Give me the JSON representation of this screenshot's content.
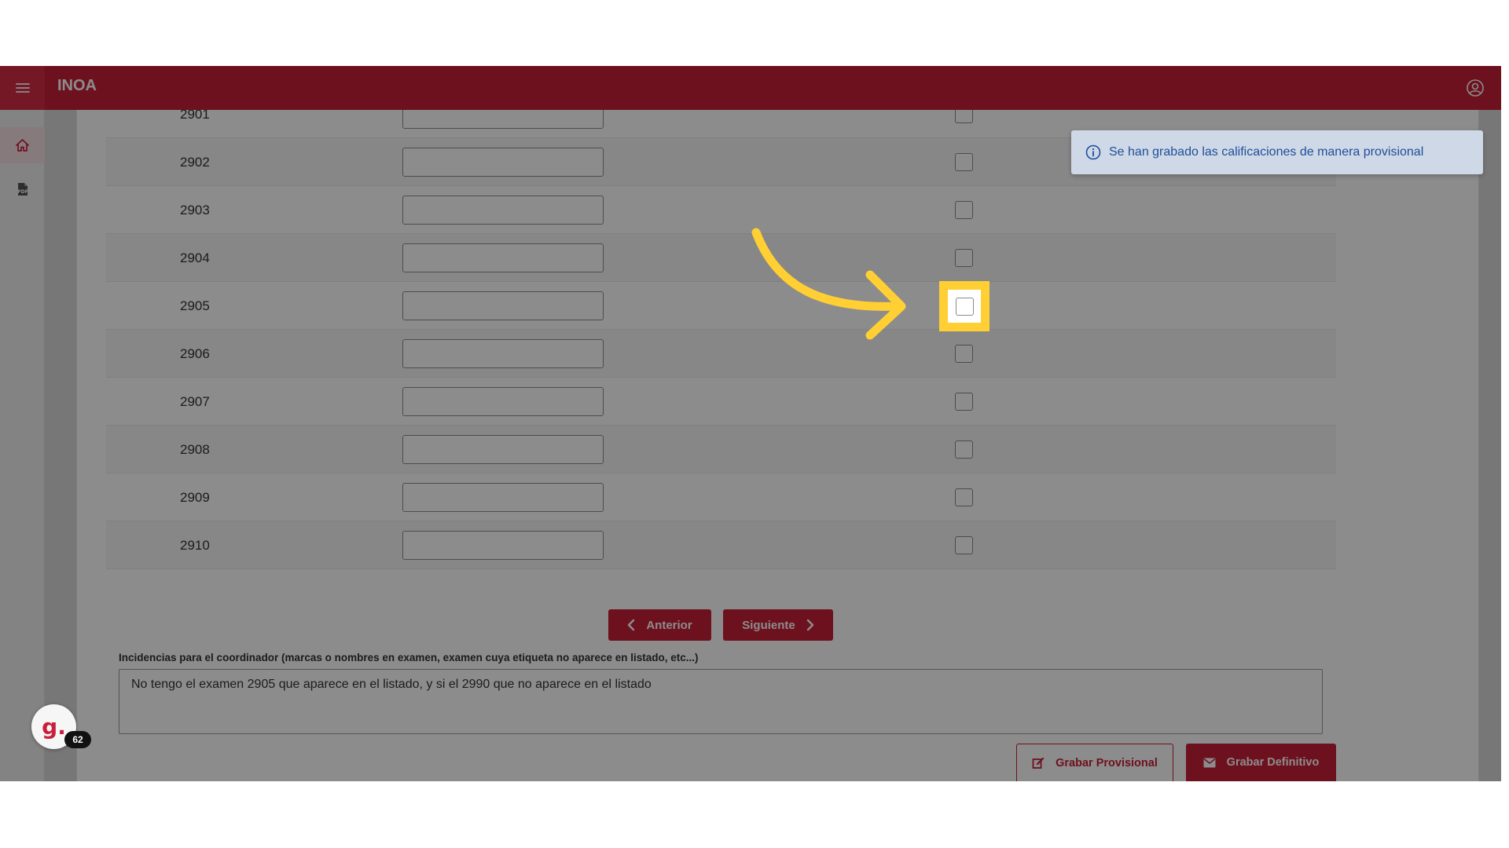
{
  "app": {
    "title": "INOA"
  },
  "sidebar": {
    "items": [
      {
        "icon": "home-icon"
      },
      {
        "icon": "pdf-file-icon"
      }
    ]
  },
  "rows": [
    {
      "number": "2901",
      "grade": "",
      "checked": false
    },
    {
      "number": "2902",
      "grade": "",
      "checked": false
    },
    {
      "number": "2903",
      "grade": "",
      "checked": false
    },
    {
      "number": "2904",
      "grade": "",
      "checked": false
    },
    {
      "number": "2905",
      "grade": "",
      "checked": false,
      "highlighted": true
    },
    {
      "number": "2906",
      "grade": "",
      "checked": false
    },
    {
      "number": "2907",
      "grade": "",
      "checked": false
    },
    {
      "number": "2908",
      "grade": "",
      "checked": false
    },
    {
      "number": "2909",
      "grade": "",
      "checked": false
    },
    {
      "number": "2910",
      "grade": "",
      "checked": false
    }
  ],
  "pagination": {
    "prev_label": "Anterior",
    "next_label": "Siguiente"
  },
  "incidencias": {
    "label": "Incidencias para el coordinador (marcas o nombres en examen, examen cuya etiqueta no aparece en listado, etc...)",
    "value": "No tengo el examen 2905 que aparece en el listado, y si el 2990 que no aparece en el listado"
  },
  "actions": {
    "provisional_label": "Grabar Provisional",
    "definitivo_label": "Grabar Definitivo"
  },
  "toast": {
    "message": "Se han grabado las calificaciones de manera provisional",
    "icon": "info-icon"
  },
  "widget": {
    "letter": "g.",
    "badge": "62"
  },
  "colors": {
    "brand": "#c8203a",
    "highlight": "#ffcf33",
    "toast_bg": "#cfd8e6",
    "toast_text": "#1d4f9a"
  }
}
